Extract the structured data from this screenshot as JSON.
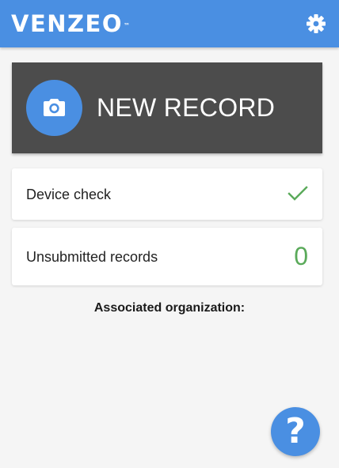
{
  "header": {
    "logo_text": "VENZEO",
    "logo_tm": "™",
    "settings_icon": "gear-icon"
  },
  "new_record": {
    "label": "NEW RECORD",
    "icon": "camera-icon"
  },
  "device_check": {
    "label": "Device check",
    "status_icon": "check-icon"
  },
  "unsubmitted": {
    "label": "Unsubmitted records",
    "count": "0"
  },
  "organization": {
    "label": "Associated organization:"
  },
  "help": {
    "glyph": "?",
    "icon": "help-icon"
  },
  "colors": {
    "primary": "#4a8fe2",
    "dark_panel": "#4c4c4c",
    "success": "#5aaa5a",
    "background": "#f5f5f5"
  }
}
